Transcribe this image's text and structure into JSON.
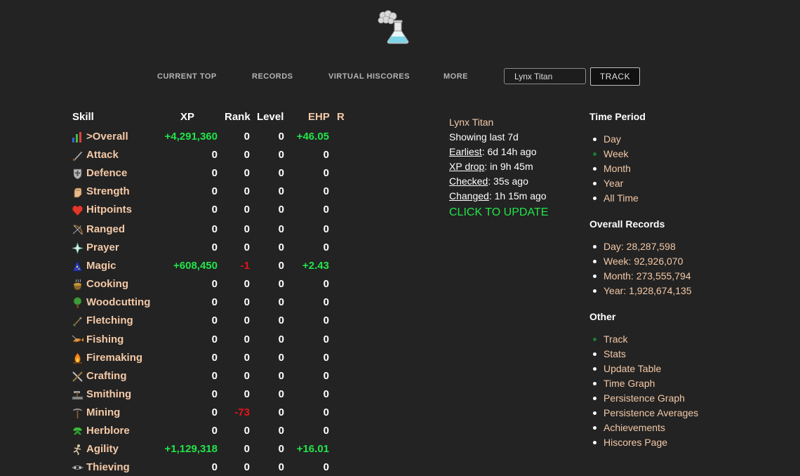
{
  "nav": {
    "items": [
      "CURRENT TOP",
      "RECORDS",
      "VIRTUAL HISCORES",
      "MORE"
    ],
    "search_value": "Lynx Titan",
    "track_label": "TRACK"
  },
  "table": {
    "headers": {
      "skill": "Skill",
      "xp": "XP",
      "rank": "Rank",
      "level": "Level",
      "ehp": "EHP",
      "r": "R"
    },
    "rows": [
      {
        "icon": "overall-icon",
        "name": ">Overall",
        "xp": "+4,291,360",
        "rank": "0",
        "level": "0",
        "ehp": "+46.05"
      },
      {
        "icon": "attack-icon",
        "name": "Attack",
        "xp": "0",
        "rank": "0",
        "level": "0",
        "ehp": "0"
      },
      {
        "icon": "defence-icon",
        "name": "Defence",
        "xp": "0",
        "rank": "0",
        "level": "0",
        "ehp": "0"
      },
      {
        "icon": "strength-icon",
        "name": "Strength",
        "xp": "0",
        "rank": "0",
        "level": "0",
        "ehp": "0"
      },
      {
        "icon": "hitpoints-icon",
        "name": "Hitpoints",
        "xp": "0",
        "rank": "0",
        "level": "0",
        "ehp": "0"
      },
      {
        "icon": "ranged-icon",
        "name": "Ranged",
        "xp": "0",
        "rank": "0",
        "level": "0",
        "ehp": "0"
      },
      {
        "icon": "prayer-icon",
        "name": "Prayer",
        "xp": "0",
        "rank": "0",
        "level": "0",
        "ehp": "0"
      },
      {
        "icon": "magic-icon",
        "name": "Magic",
        "xp": "+608,450",
        "rank": "-1",
        "level": "0",
        "ehp": "+2.43"
      },
      {
        "icon": "cooking-icon",
        "name": "Cooking",
        "xp": "0",
        "rank": "0",
        "level": "0",
        "ehp": "0"
      },
      {
        "icon": "woodcutting-icon",
        "name": "Woodcutting",
        "xp": "0",
        "rank": "0",
        "level": "0",
        "ehp": "0"
      },
      {
        "icon": "fletching-icon",
        "name": "Fletching",
        "xp": "0",
        "rank": "0",
        "level": "0",
        "ehp": "0"
      },
      {
        "icon": "fishing-icon",
        "name": "Fishing",
        "xp": "0",
        "rank": "0",
        "level": "0",
        "ehp": "0"
      },
      {
        "icon": "firemaking-icon",
        "name": "Firemaking",
        "xp": "0",
        "rank": "0",
        "level": "0",
        "ehp": "0"
      },
      {
        "icon": "crafting-icon",
        "name": "Crafting",
        "xp": "0",
        "rank": "0",
        "level": "0",
        "ehp": "0"
      },
      {
        "icon": "smithing-icon",
        "name": "Smithing",
        "xp": "0",
        "rank": "0",
        "level": "0",
        "ehp": "0"
      },
      {
        "icon": "mining-icon",
        "name": "Mining",
        "xp": "0",
        "rank": "-73",
        "level": "0",
        "ehp": "0"
      },
      {
        "icon": "herblore-icon",
        "name": "Herblore",
        "xp": "0",
        "rank": "0",
        "level": "0",
        "ehp": "0"
      },
      {
        "icon": "agility-icon",
        "name": "Agility",
        "xp": "+1,129,318",
        "rank": "0",
        "level": "0",
        "ehp": "+16.01"
      },
      {
        "icon": "thieving-icon",
        "name": "Thieving",
        "xp": "0",
        "rank": "0",
        "level": "0",
        "ehp": "0"
      }
    ]
  },
  "player": {
    "name": "Lynx Titan",
    "showing": "Showing last 7d",
    "earliest_label": "Earliest",
    "earliest_value": ": 6d 14h ago",
    "xpdrop_label": "XP drop",
    "xpdrop_value": ": in 9h 45m",
    "checked_label": "Checked",
    "checked_value": ": 35s ago",
    "changed_label": "Changed",
    "changed_value": ": 1h 15m ago",
    "update_label": "CLICK TO UPDATE"
  },
  "time_period": {
    "title": "Time Period",
    "items": [
      "Day",
      "Week",
      "Month",
      "Year",
      "All Time"
    ],
    "active": "Week"
  },
  "overall_records": {
    "title": "Overall Records",
    "items": [
      "Day: 28,287,598",
      "Week: 92,926,070",
      "Month: 273,555,794",
      "Year: 1,928,674,135"
    ]
  },
  "other": {
    "title": "Other",
    "items": [
      "Track",
      "Stats",
      "Update Table",
      "Time Graph",
      "Persistence Graph",
      "Persistence Averages",
      "Achievements",
      "Hiscores Page"
    ],
    "active": "Track"
  },
  "colors": {
    "background": "#232323",
    "skill_name": "#f4c9a7",
    "gain": "#22e44a",
    "loss": "#e8121a",
    "active_bullet": "#1e7a35"
  }
}
